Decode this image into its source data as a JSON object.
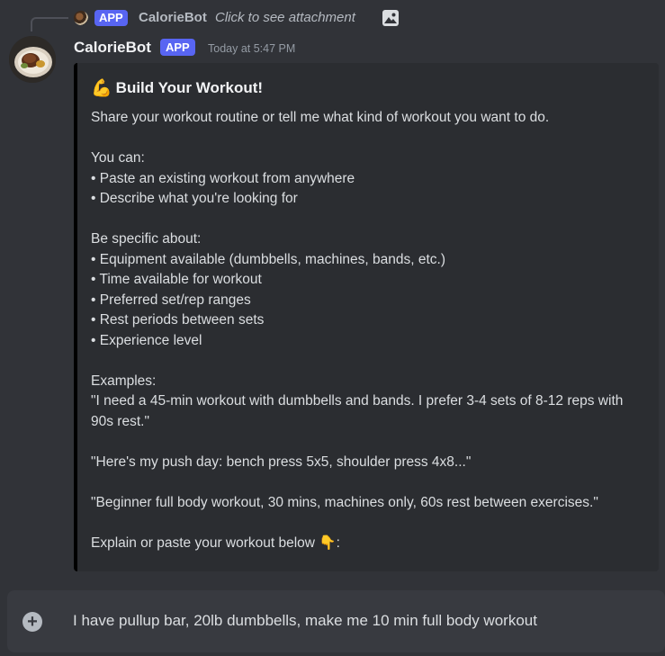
{
  "reply": {
    "badge": "APP",
    "author": "CalorieBot",
    "text": "Click to see attachment",
    "attachment_icon": "image-icon"
  },
  "message": {
    "author": "CalorieBot",
    "badge": "APP",
    "timestamp": "Today at 5:47 PM",
    "avatar_icon": "food-plate-avatar"
  },
  "embed": {
    "title_emoji": "💪",
    "title": "Build Your Workout!",
    "lines": [
      "Share your workout routine or tell me what kind of workout you want to do.",
      "",
      "You can:",
      "• Paste an existing workout from anywhere",
      "• Describe what you're looking for",
      "",
      "Be specific about:",
      "• Equipment available (dumbbells, machines, bands, etc.)",
      "• Time available for workout",
      "• Preferred set/rep ranges",
      "• Rest periods between sets",
      "• Experience level",
      "",
      "Examples:",
      "\"I need a 45-min workout with dumbbells and bands. I prefer 3-4 sets of 8-12 reps with 90s rest.\"",
      "",
      "\"Here's my push day: bench press 5x5, shoulder press 4x8...\"",
      "",
      "\"Beginner full body workout, 30 mins, machines only, 60s rest between exercises.\"",
      "",
      "Explain or paste your workout below 👇:"
    ],
    "accent_color": "#000000"
  },
  "input": {
    "value": "I have pullup bar, 20lb dumbbells, make me 10 min full body workout",
    "plus_icon": "plus-circle-icon"
  },
  "colors": {
    "background": "#313338",
    "embed_background": "#2b2d31",
    "badge": "#5865f2",
    "input_background": "#383a40"
  }
}
